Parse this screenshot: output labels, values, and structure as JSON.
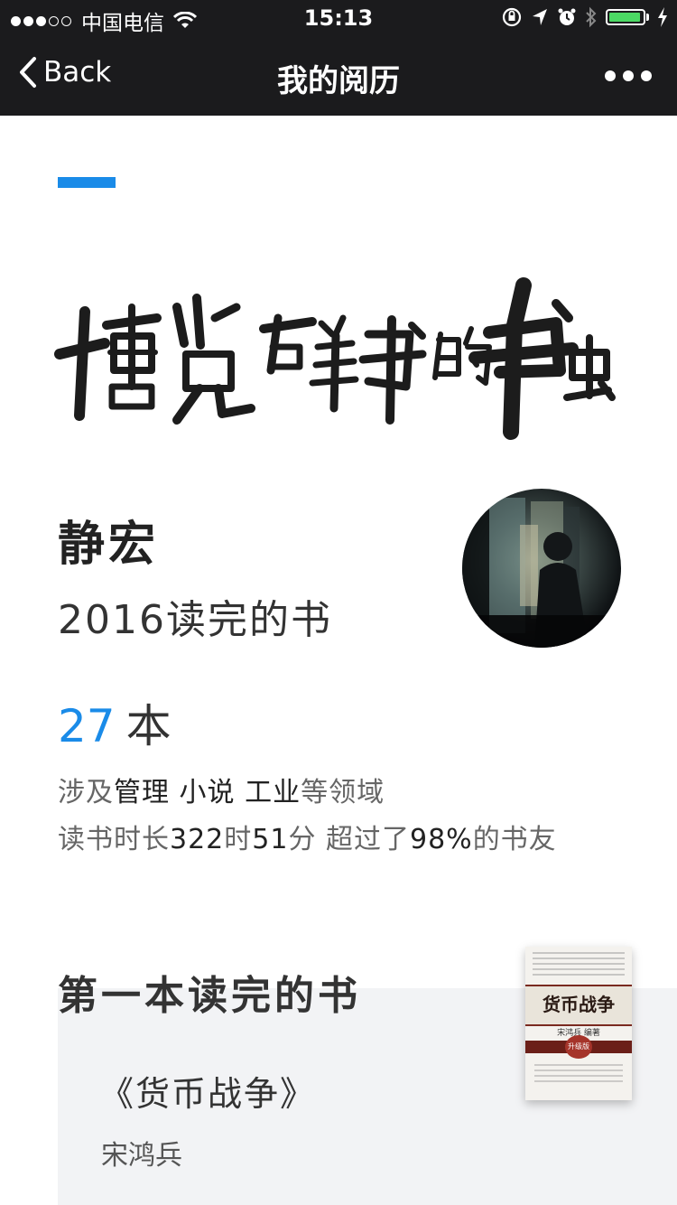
{
  "status_bar": {
    "carrier": "中国电信",
    "time": "15:13",
    "signal_dots_filled": 3,
    "signal_dots_total": 5,
    "battery_level": 0.95,
    "battery_color": "#4cd964"
  },
  "nav": {
    "back_label": "Back",
    "title": "我的阅历"
  },
  "banner": {
    "calligraphy_text": "博览群书的书虫"
  },
  "profile": {
    "name": "静宏",
    "year_label": "2016读完的书"
  },
  "stats": {
    "count": "27",
    "unit": "本",
    "fields_prefix": "涉及",
    "fields": "管理 小说 工业",
    "fields_suffix": "等领域",
    "duration_prefix": "读书时长",
    "hours": "322",
    "hours_unit": "时",
    "minutes": "51",
    "minutes_unit": "分 超过了",
    "percent": "98%",
    "percent_suffix": "的书友"
  },
  "first_book": {
    "section_title": "第一本读完的书",
    "title": "《货币战争》",
    "author": "宋鸿兵",
    "cover_title": "货币战争",
    "cover_author": "宋鸿兵 编著",
    "cover_badge": "升级版"
  },
  "colors": {
    "accent": "#1a8be8",
    "navbar_bg": "#1b1b1d",
    "card_bg": "#f2f3f5"
  }
}
